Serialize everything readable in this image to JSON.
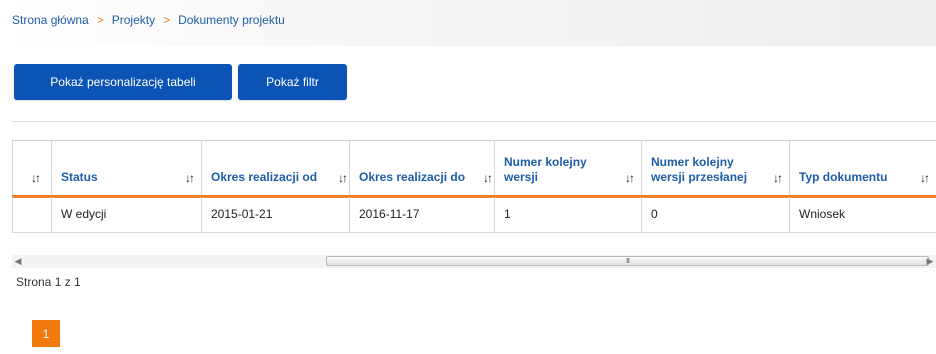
{
  "breadcrumb": {
    "items": [
      "Strona główna",
      "Projekty",
      "Dokumenty projektu"
    ],
    "separator": ">"
  },
  "toolbar": {
    "personalize_label": "Pokaż personalizację tabeli",
    "filter_label": "Pokaż filtr"
  },
  "table": {
    "sort_glyph": "↓↑",
    "columns": [
      {
        "label": ""
      },
      {
        "label": "Status"
      },
      {
        "label": "Okres realizacji od"
      },
      {
        "label": "Okres realizacji do"
      },
      {
        "label": "Numer kolejny wersji",
        "line1": "Numer kolejny",
        "line2": "wersji"
      },
      {
        "label": "Numer kolejny wersji przesłanej",
        "line1": "Numer kolejny",
        "line2": "wersji przesłanej"
      },
      {
        "label": "Typ dokumentu"
      }
    ],
    "rows": [
      [
        "",
        "W edycji",
        "2015-01-21",
        "2016-11-17",
        "1",
        "0",
        "Wniosek"
      ]
    ]
  },
  "scrollbar": {
    "grip": "III"
  },
  "pagination": {
    "info": "Strona 1 z 1",
    "current_page": "1"
  },
  "colors": {
    "accent": "#f0812a",
    "primary": "#0b54b6",
    "link": "#1d5ea8"
  }
}
